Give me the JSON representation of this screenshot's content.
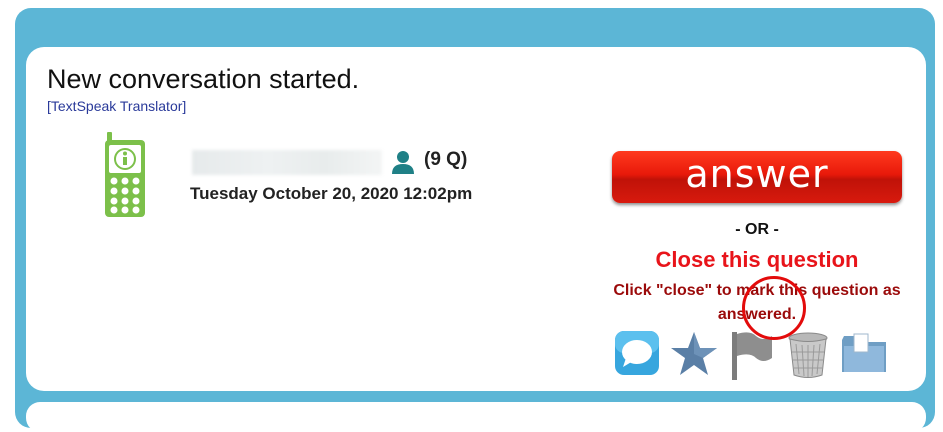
{
  "card": {
    "title": "New conversation started.",
    "translator_link": "[TextSpeak Translator]"
  },
  "customer": {
    "question_count": "(9 Q)",
    "date": "Tuesday October 20, 2020 12:02pm",
    "device_icon": "phone-info-icon",
    "user_icon": "person-icon"
  },
  "actions": {
    "answer_label": "answer",
    "or_label": "- OR -",
    "close_label": "Close this question",
    "close_description": "Click \"close\" to mark this question as answered.",
    "icons": [
      "chat-bubble-icon",
      "star-icon",
      "flag-icon",
      "trash-can-icon",
      "folder-icon"
    ]
  },
  "colors": {
    "frame": "#5cb6d6",
    "answer_button": "#e8190a",
    "close_text": "#e8141a",
    "description_text": "#9b0a0a",
    "highlight_ring": "#e30b0b",
    "phone_green": "#7cc04a"
  }
}
